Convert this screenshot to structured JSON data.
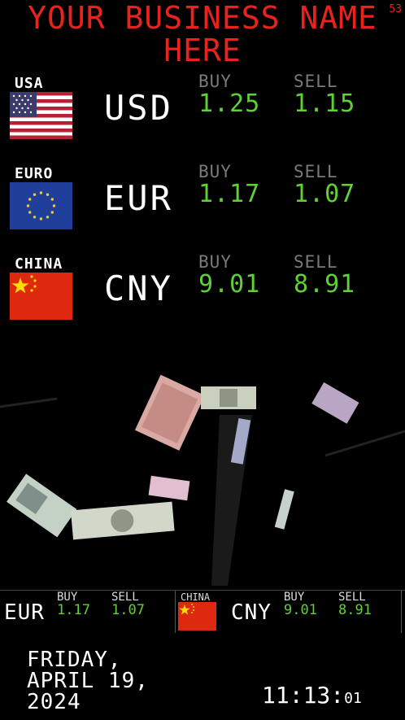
{
  "header": {
    "title_line1": "YOUR BUSINESS NAME",
    "title_line2": "HERE",
    "corner_badge": "53"
  },
  "rates": [
    {
      "label": "USA",
      "code": "USD",
      "buy_label": "BUY",
      "sell_label": "SELL",
      "buy": "1.25",
      "sell": "1.15"
    },
    {
      "label": "EURO",
      "code": "EUR",
      "buy_label": "BUY",
      "sell_label": "SELL",
      "buy": "1.17",
      "sell": "1.07"
    },
    {
      "label": "CHINA",
      "code": "CNY",
      "buy_label": "BUY",
      "sell_label": "SELL",
      "buy": "9.01",
      "sell": "8.91"
    }
  ],
  "ticker": [
    {
      "code": "EUR",
      "buy_label": "BUY",
      "sell_label": "SELL",
      "buy": "1.17",
      "sell": "1.07"
    },
    {
      "flag_label": "CHINA",
      "code": "CNY",
      "buy_label": "BUY",
      "sell_label": "SELL",
      "buy": "9.01",
      "sell": "8.91"
    }
  ],
  "date": {
    "line1": "FRIDAY,",
    "line2": "APRIL 19,",
    "line3": "2024"
  },
  "clock": {
    "hm": "11:13:",
    "sec": "01"
  },
  "colors": {
    "title": "#e8221e",
    "value": "#5fd134",
    "header": "#7a7a7a",
    "background": "#000000"
  },
  "icons": [
    "usa-flag-icon",
    "eu-flag-icon",
    "china-flag-icon"
  ]
}
